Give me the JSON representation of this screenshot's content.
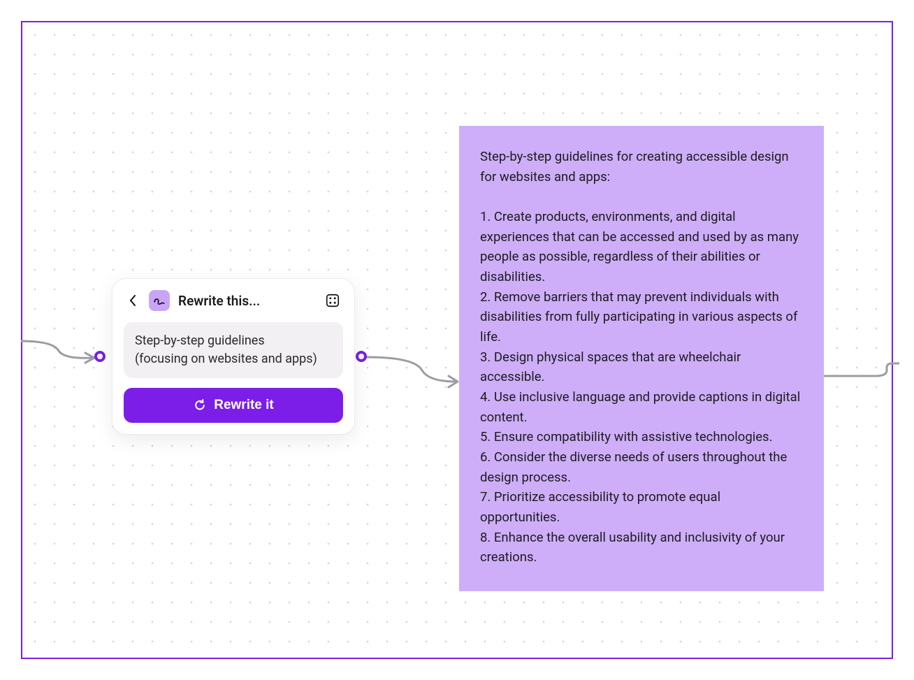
{
  "colors": {
    "accent": "#7C1EE8",
    "note_bg": "#CEAEF9",
    "card_bg": "#FFFFFF",
    "input_bg": "#F2F0F3"
  },
  "icons": {
    "back": "chevron-left-icon",
    "rewrite_tool": "scribble-icon",
    "dice": "randomize-dice-icon",
    "refresh": "refresh-icon"
  },
  "card": {
    "title": "Rewrite this...",
    "input_text": "Step-by-step guidelines\n(focusing on websites and apps)",
    "button_label": "Rewrite it"
  },
  "note": {
    "text": "Step-by-step guidelines for creating accessible design for websites and apps:\n\n1. Create products, environments, and digital experiences that can be accessed and used by as many people as possible, regardless of their abilities or disabilities.\n2. Remove barriers that may prevent individuals with disabilities from fully participating in various aspects of life.\n3. Design physical spaces that are wheelchair accessible.\n4. Use inclusive language and provide captions in digital content.\n5. Ensure compatibility with assistive technologies.\n6. Consider the diverse needs of users throughout the design process.\n7. Prioritize accessibility to promote equal opportunities.\n8. Enhance the overall usability and inclusivity of your creations."
  }
}
